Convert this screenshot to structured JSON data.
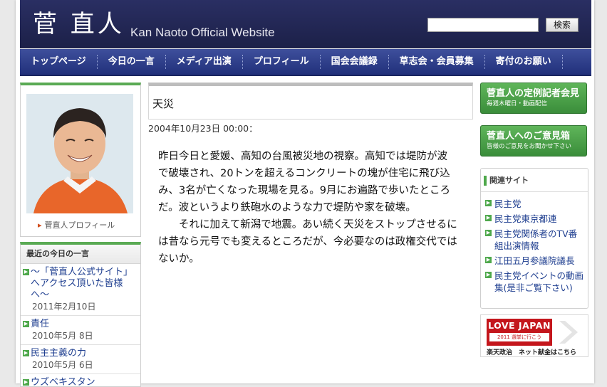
{
  "header": {
    "title": "菅 直人",
    "subtitle": "Kan Naoto Official Website",
    "search_button": "検索",
    "search_value": ""
  },
  "nav": {
    "items": [
      {
        "label": "トップページ"
      },
      {
        "label": "今日の一言"
      },
      {
        "label": "メディア出演"
      },
      {
        "label": "プロフィール"
      },
      {
        "label": "国会会議録"
      },
      {
        "label": "草志会・会員募集"
      },
      {
        "label": "寄付のお願い"
      }
    ]
  },
  "profile": {
    "link_label": "菅直人プロフィール"
  },
  "recent": {
    "title": "最近の今日の一言",
    "items": [
      {
        "title": "〜「菅直人公式サイト」へアクセス頂いた皆様へ〜",
        "date": "2011年2月10日"
      },
      {
        "title": "責任",
        "date": "2010年5月  8日"
      },
      {
        "title": "民主主義の力",
        "date": "2010年5月  6日"
      },
      {
        "title": "ウズベキスタン",
        "date": ""
      }
    ]
  },
  "entry": {
    "title": "天災",
    "date": "2004年10月23日 00:00：",
    "paragraph1": "昨日今日と愛媛、高知の台風被災地の視察。高知では堤防が波で破壊され、20トンを超えるコンクリートの塊が住宅に飛び込み、3名が亡くなった現場を見る。9月にお遍路で歩いたところだ。波というより鉄砲水のような力で堤防や家を破壊。",
    "paragraph2": "それに加えて新潟で地震。あい続く天災をストップさせるには昔なら元号でも変えるところだが、今必要なのは政権交代ではないか。"
  },
  "sidebar": {
    "press_button": {
      "main": "菅直人の定例記者会見",
      "sub": "毎週木曜日・動画配信"
    },
    "opinion_button": {
      "main": "菅直人へのご意見箱",
      "sub": "皆様のご意見をお聞かせ下さい"
    },
    "related_title": "関連サイト",
    "related_links": [
      {
        "label": "民主党"
      },
      {
        "label": "民主党東京都連"
      },
      {
        "label": "民主党関係者のTV番組出演情報"
      },
      {
        "label": "江田五月参議院議長"
      },
      {
        "label": "民主党イベントの動画集(是非ご覧下さい)"
      }
    ],
    "banner": {
      "line1": "LOVE JAPAN",
      "line2": "2011 選挙に行こう",
      "caption": "楽天政治　ネット献金はこちら"
    }
  },
  "colors": {
    "header_bg": "#1c2048",
    "nav_bg": "#2a3a8a",
    "accent_green": "#4ea84b",
    "link": "#1d3d8f",
    "banner_red": "#c4161c"
  }
}
